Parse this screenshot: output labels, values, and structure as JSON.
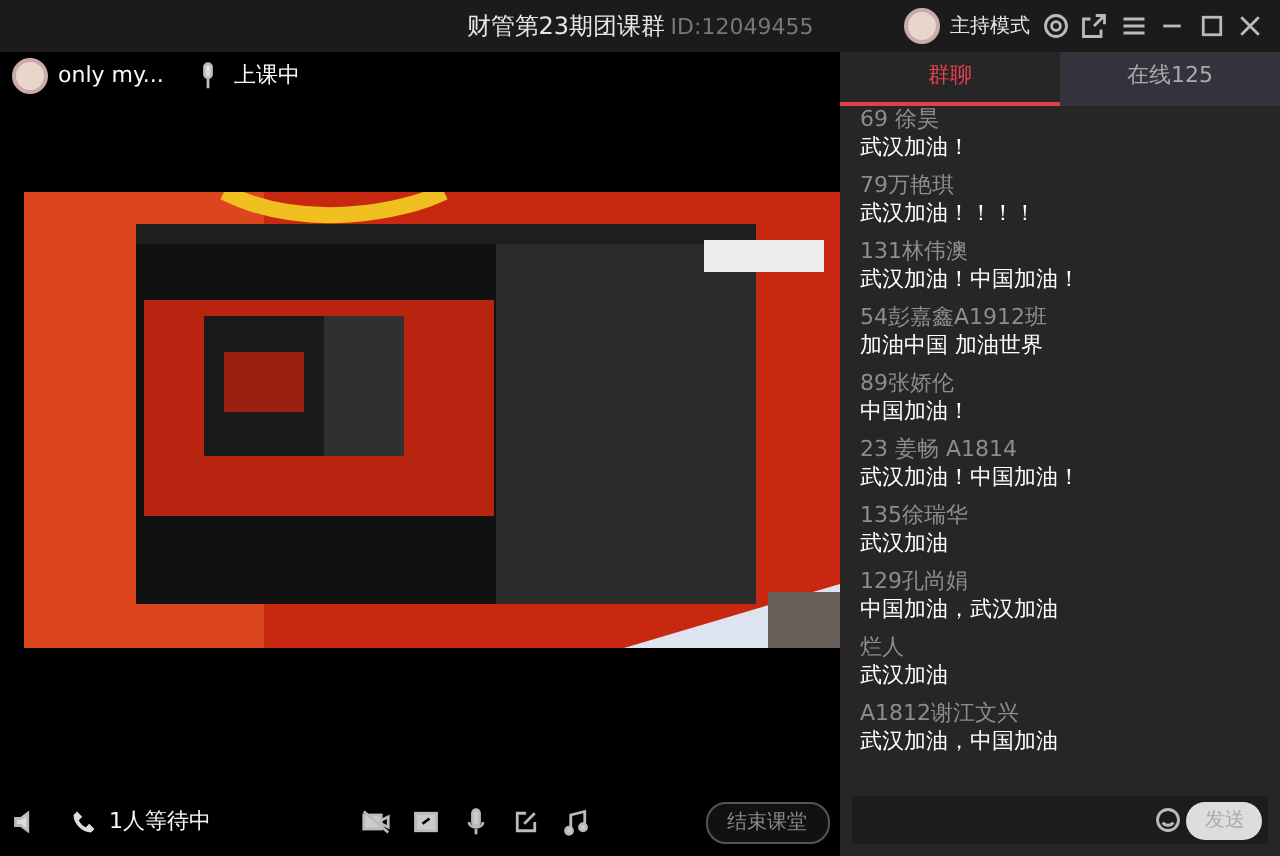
{
  "window": {
    "title": "财管第23期团课群",
    "id_label": "ID:12049455",
    "mode": "主持模式"
  },
  "header": {
    "user": "only my...",
    "status": "上课中"
  },
  "toolbar": {
    "waiting": "1人等待中",
    "end_button": "结束课堂"
  },
  "tabs": [
    {
      "label": "群聊",
      "selected": true
    },
    {
      "label": "在线125",
      "selected": false
    }
  ],
  "messages": [
    {
      "name": "69 徐昊",
      "text": "武汉加油！"
    },
    {
      "name": "79万艳琪",
      "text": "武汉加油！！！！"
    },
    {
      "name": "131林伟澳",
      "text": "武汉加油！中国加油！"
    },
    {
      "name": "54彭嘉鑫A1912班",
      "text": "加油中国  加油世界"
    },
    {
      "name": "89张娇伦",
      "text": "中国加油！"
    },
    {
      "name": "23 姜畅 A1814",
      "text": "武汉加油！中国加油！"
    },
    {
      "name": "135徐瑞华",
      "text": "武汉加油"
    },
    {
      "name": "129孔尚娟",
      "text": "中国加油，武汉加油"
    },
    {
      "name": "烂人",
      "text": "武汉加油"
    },
    {
      "name": "A1812谢江文兴",
      "text": "武汉加油，中国加油"
    }
  ],
  "composer": {
    "send": "发送"
  }
}
